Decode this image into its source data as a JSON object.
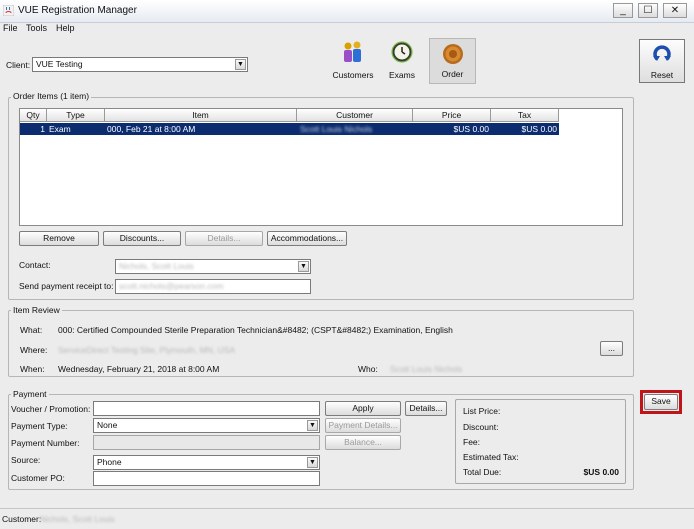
{
  "window": {
    "title": "VUE Registration Manager",
    "controls": [
      "_",
      "☐",
      "✕"
    ]
  },
  "menu": [
    "File",
    "Tools",
    "Help"
  ],
  "client": {
    "label": "Client:",
    "value": "VUE Testing"
  },
  "toolbar": {
    "customers": "Customers",
    "exams": "Exams",
    "order": "Order",
    "reset": "Reset"
  },
  "order_items": {
    "title": "Order Items (1 item)",
    "columns": [
      "Qty",
      "Type",
      "Item",
      "Customer",
      "Price",
      "Tax"
    ],
    "rows": [
      {
        "qty": "1",
        "type": "Exam",
        "item": "000, Feb 21 at 8:00 AM",
        "customer": "Scott Louis Nichols",
        "price": "$US 0.00",
        "tax": "$US 0.00"
      }
    ],
    "buttons": {
      "remove": "Remove",
      "discounts": "Discounts...",
      "details": "Details...",
      "accommodations": "Accommodations..."
    },
    "contact_label": "Contact:",
    "contact_value": "Nichols, Scott Louis",
    "receipt_label": "Send payment receipt to:",
    "receipt_value": "scott.nichols@pearson.com"
  },
  "item_review": {
    "title": "Item Review",
    "what_label": "What:",
    "what_value": "000: Certified Compounded Sterile Preparation Technician&#8482; (CSPT&#8482;) Examination, English",
    "where_label": "Where:",
    "where_value": "ServiceDirect Testing Site, Plymouth, MN, USA",
    "where_button": "...",
    "when_label": "When:",
    "when_value": "Wednesday, February 21, 2018 at 8:00 AM",
    "who_label": "Who:",
    "who_value": "Scott Louis Nichols"
  },
  "payment": {
    "title": "Payment",
    "voucher_label": "Voucher / Promotion:",
    "voucher_value": "",
    "apply": "Apply",
    "details": "Details...",
    "type_label": "Payment Type:",
    "type_value": "None",
    "payment_details": "Payment Details...",
    "number_label": "Payment Number:",
    "number_value": "",
    "balance": "Balance...",
    "source_label": "Source:",
    "source_value": "Phone",
    "po_label": "Customer PO:",
    "po_value": "",
    "summary": {
      "list_price": "List Price:",
      "discount": "Discount:",
      "fee": "Fee:",
      "estimated_tax": "Estimated Tax:",
      "total_due": "Total Due:",
      "total_value": "$US 0.00"
    }
  },
  "save": "Save",
  "status": {
    "label": "Customer:",
    "value": "Nichols, Scott Louis"
  },
  "colors": {
    "selection": "#0b2c6f",
    "highlight": "#c0141b"
  }
}
